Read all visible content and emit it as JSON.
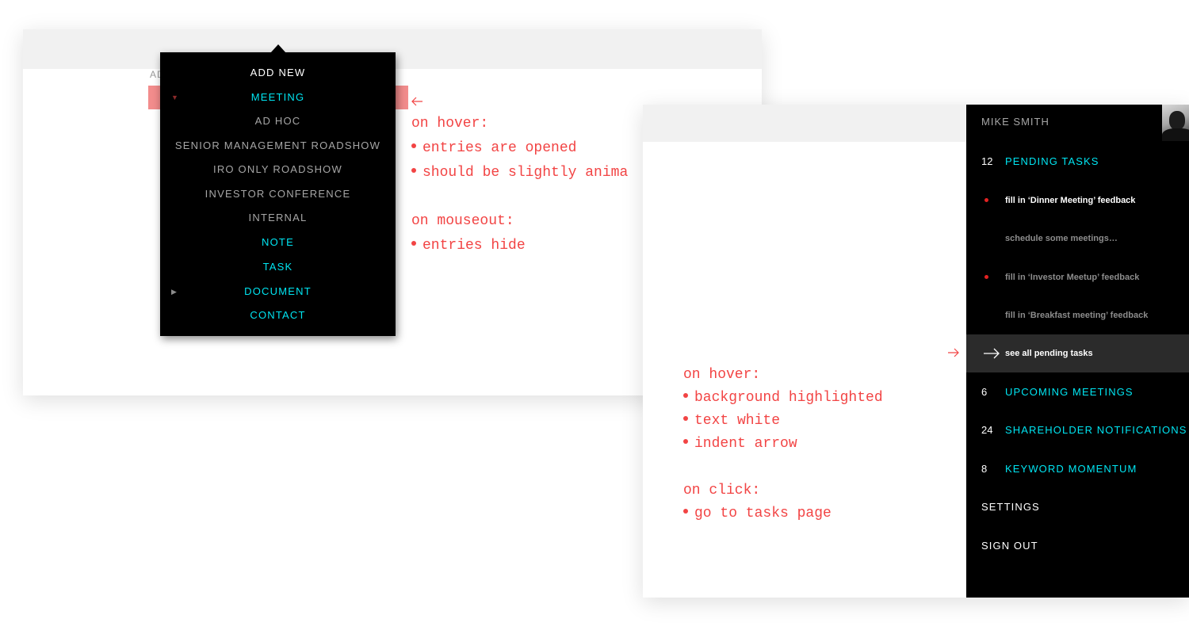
{
  "panel1": {
    "label_partial": "AD",
    "dropdown": {
      "header": "ADD NEW",
      "items": [
        {
          "label": "MEETING",
          "style": "cyan",
          "toggle": "open"
        },
        {
          "label": "AD HOC",
          "style": "gray"
        },
        {
          "label": "SENIOR MANAGEMENT ROADSHOW",
          "style": "gray"
        },
        {
          "label": "IRO ONLY ROADSHOW",
          "style": "gray"
        },
        {
          "label": "INVESTOR CONFERENCE",
          "style": "gray"
        },
        {
          "label": "INTERNAL",
          "style": "gray"
        },
        {
          "label": "NOTE",
          "style": "cyan"
        },
        {
          "label": "TASK",
          "style": "cyan"
        },
        {
          "label": "DOCUMENT",
          "style": "cyan",
          "toggle": "closed"
        },
        {
          "label": "CONTACT",
          "style": "cyan"
        }
      ],
      "toggle_open_icon": "triangle-down-icon",
      "toggle_closed_icon": "triangle-right-icon"
    },
    "annotations": {
      "line1": "on hover:",
      "line2": "entries are opened",
      "line3": "should be slightly anima",
      "line4": "on mouseout:",
      "line5": "entries hide"
    }
  },
  "panel2": {
    "user_name": "MIKE SMITH",
    "avatar_icon": "user-avatar",
    "sections": [
      {
        "count": "12",
        "label": "PENDING TASKS"
      },
      {
        "count": "6",
        "label": "UPCOMING MEETINGS"
      },
      {
        "count": "24",
        "label": "SHAREHOLDER NOTIFICATIONS"
      },
      {
        "count": "8",
        "label": "KEYWORD MOMENTUM"
      }
    ],
    "tasks": [
      {
        "text": "fill in  ‘Dinner Meeting’ feedback",
        "urgent": true,
        "active": true
      },
      {
        "text": "schedule some meetings…",
        "urgent": false,
        "active": false
      },
      {
        "text": "fill in  ‘Investor Meetup’ feedback",
        "urgent": true,
        "active": false
      },
      {
        "text": "fill in ‘Breakfast meeting’ feedback",
        "urgent": false,
        "active": false
      }
    ],
    "see_all": "see all pending tasks",
    "settings": "SETTINGS",
    "sign_out": "SIGN OUT",
    "annotations": {
      "line1": "on hover:",
      "line2": "background highlighted",
      "line3": "text white",
      "line4": "indent arrow",
      "line5": "on click:",
      "line6": "go to tasks page"
    }
  },
  "colors": {
    "accent_cyan": "#00e5f2",
    "annotation_red": "#f24444",
    "urgent_red": "#e32222",
    "hover_bg": "#2b2b2b",
    "highlight_pink": "#f28c8c"
  }
}
